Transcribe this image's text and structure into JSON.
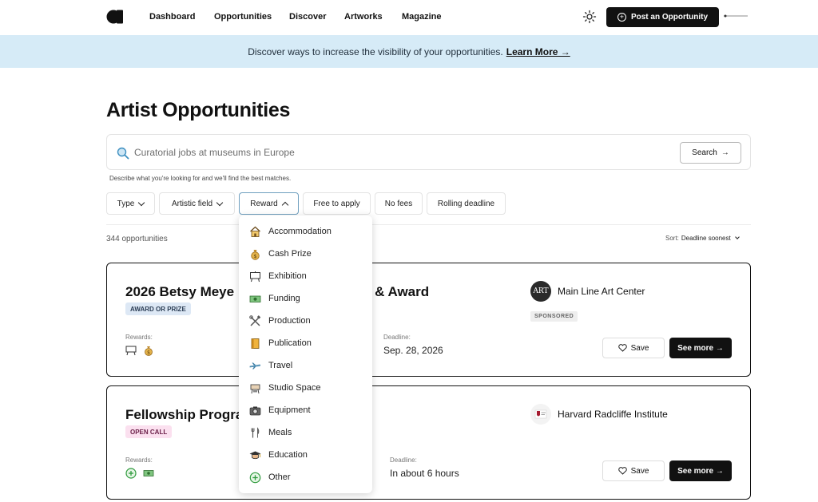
{
  "nav": {
    "logo_icon": "circle-a-logo",
    "links": [
      "Dashboard",
      "Opportunities",
      "Discover",
      "Artworks",
      "Magazine"
    ],
    "theme_icon": "sun-icon",
    "post_label": "Post an Opportunity"
  },
  "banner": {
    "text": "Discover ways to increase the visibility of your opportunities.",
    "link": "Learn More →",
    "bg_color": "#d6ebf7"
  },
  "page": {
    "title": "Artist Opportunities"
  },
  "search": {
    "placeholder": "Curatorial jobs at museums in Europe",
    "button": "Search",
    "hint": "Describe what you're looking for and we'll find the best matches."
  },
  "filters": {
    "type": "Type",
    "field": "Artistic field",
    "reward": "Reward",
    "free": "Free to apply",
    "nofees": "No fees",
    "rolling": "Rolling deadline"
  },
  "results": {
    "count": "344 opportunities",
    "sort_label": "Sort:",
    "sort_value": "Deadline soonest"
  },
  "reward_menu": {
    "items": [
      "Accommodation",
      "Cash Prize",
      "Exhibition",
      "Funding",
      "Production",
      "Publication",
      "Travel",
      "Studio Space",
      "Equipment",
      "Meals",
      "Education",
      "Other"
    ],
    "icons": [
      "house-icon",
      "money-bag-icon",
      "easel-icon",
      "banknote-icon",
      "tools-icon",
      "book-icon",
      "airplane-icon",
      "studio-icon",
      "camera-icon",
      "fork-knife-icon",
      "graduation-cap-icon",
      "plus-circle-icon"
    ]
  },
  "cards": [
    {
      "title_visible": "2026 Betsy Meye",
      "title_tail": "n & Award",
      "badge": "AWARD OR PRIZE",
      "rewards_label": "Rewards:",
      "reward_icons": [
        "easel-icon",
        "money-bag-icon"
      ],
      "deadline_label": "Deadline:",
      "deadline": "Sep. 28, 2026",
      "org": "Main Line Art Center",
      "org_logo_text": "ART",
      "sponsored": "SPONSORED",
      "save": "Save",
      "more": "See more →"
    },
    {
      "title_visible": "Fellowship Progra",
      "badge": "OPEN CALL",
      "rewards_label": "Rewards:",
      "reward_icons": [
        "plus-circle-icon",
        "banknote-icon"
      ],
      "deadline_label": "Deadline:",
      "deadline": "In about 6 hours",
      "org": "Harvard Radcliffe Institute",
      "save": "Save",
      "more": "See more →"
    }
  ]
}
